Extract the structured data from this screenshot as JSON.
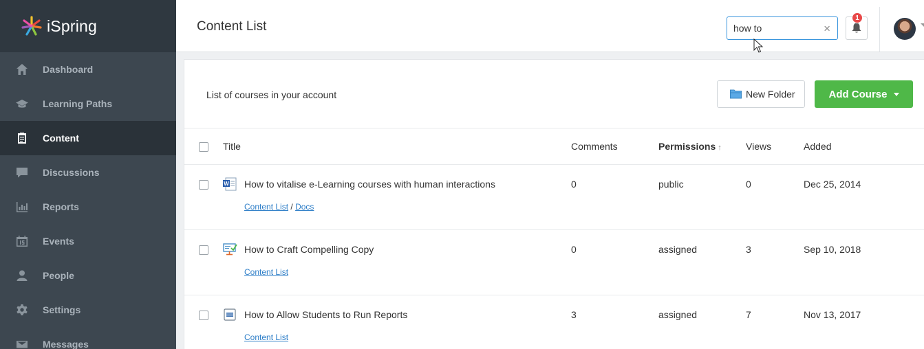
{
  "brand": {
    "name": "iSpring"
  },
  "sidebar": {
    "items": [
      {
        "label": "Dashboard",
        "icon": "home-icon",
        "active": false
      },
      {
        "label": "Learning Paths",
        "icon": "graduation-cap-icon",
        "active": false
      },
      {
        "label": "Content",
        "icon": "clipboard-icon",
        "active": true
      },
      {
        "label": "Discussions",
        "icon": "chat-bubble-icon",
        "active": false
      },
      {
        "label": "Reports",
        "icon": "bar-chart-icon",
        "active": false
      },
      {
        "label": "Events",
        "icon": "calendar-icon",
        "active": false
      },
      {
        "label": "People",
        "icon": "person-icon",
        "active": false
      },
      {
        "label": "Settings",
        "icon": "gear-icon",
        "active": false
      },
      {
        "label": "Messages",
        "icon": "envelope-icon",
        "active": false
      }
    ]
  },
  "header": {
    "title": "Content List",
    "search": {
      "value": "how to",
      "clear_label": "×"
    },
    "notifications": {
      "count": "1"
    }
  },
  "main": {
    "description": "List of courses in your account",
    "new_folder_label": "New Folder",
    "add_course_label": "Add Course",
    "columns": {
      "title": "Title",
      "comments": "Comments",
      "permissions": "Permissions",
      "permissions_sort": "↑",
      "views": "Views",
      "added": "Added"
    },
    "rows": [
      {
        "icon": "word-document-icon",
        "title": "How to vitalise e-Learning courses with human interactions",
        "crumbs": [
          "Content List",
          "Docs"
        ],
        "crumb_sep": "/",
        "comments": "0",
        "permissions": "public",
        "views": "0",
        "added": "Dec 25, 2014"
      },
      {
        "icon": "presentation-quiz-icon",
        "title": "How to Craft Compelling Copy",
        "crumbs": [
          "Content List"
        ],
        "comments": "0",
        "permissions": "assigned",
        "views": "3",
        "added": "Sep 10, 2018"
      },
      {
        "icon": "video-file-icon",
        "title": "How to Allow Students to Run Reports",
        "crumbs": [
          "Content List"
        ],
        "comments": "3",
        "permissions": "assigned",
        "views": "7",
        "added": "Nov 13, 2017"
      }
    ]
  },
  "colors": {
    "sidebar_bg": "#3d4750",
    "accent_green": "#4fb848",
    "link_blue": "#2f7fc8",
    "badge_red": "#e84848"
  }
}
